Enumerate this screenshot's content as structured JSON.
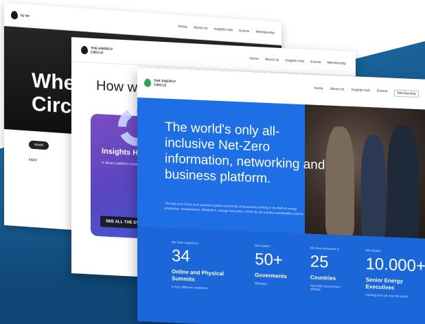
{
  "brand": {
    "by": "by ae",
    "name_line1": "THE ENERGY",
    "name_line2": "CIRCLE"
  },
  "nav": {
    "home": "Home",
    "about": "About Us",
    "insights": "Insights Hub",
    "events": "Events",
    "membership": "Membership"
  },
  "card1": {
    "hero_line1": "Whe",
    "hero_line2": "Circl",
    "pill": "World",
    "month": "MAY"
  },
  "card2": {
    "heading": "How we",
    "insights_title": "Insights H",
    "insights_text": "A vibrant platform f informed conversati and discussion",
    "button": "SEE ALL THE EVE"
  },
  "card3": {
    "headline": "The world's only all-inclusive Net-Zero information, networking and business platform.",
    "paragraph": "The Net-Zero Circle is an exclusive global community of executives working in the field of energy production, transportation, distribution, storage and policy. Driven by the leading sustainability experts.",
    "stats": [
      {
        "kicker": "We have organized",
        "number": "34",
        "label": "Online and Physical Summits",
        "sub": "In four different continents"
      },
      {
        "kicker": "We hosted",
        "number": "50+",
        "label": "Goverments",
        "sub": "Ministers"
      },
      {
        "kicker": "We have presence in",
        "number": "25",
        "label": "Countries",
        "sub": "And their Government officials"
      },
      {
        "kicker": "We hosted",
        "number": "10.000+",
        "label": "Senior Energy Executives",
        "sub": "Coming from all over the world"
      }
    ]
  },
  "colors": {
    "primary_blue": "#1e6fe6",
    "bg_blue": "#175a8f",
    "purple": "#6a47c2"
  }
}
